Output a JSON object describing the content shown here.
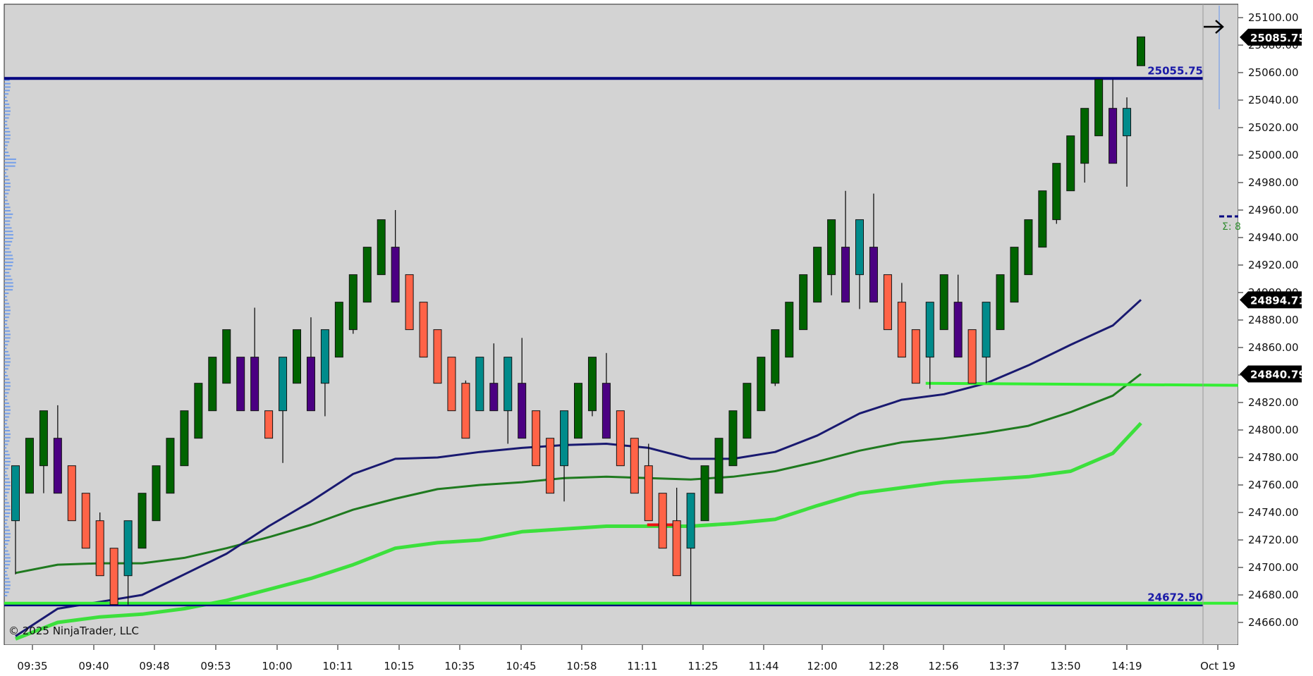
{
  "copyright": "© 2025 NinjaTrader, LLC",
  "sigma_label": "Σ: 8",
  "colors": {
    "background": "#d3d3d3",
    "bull": "#006400",
    "bear": "#ff6347",
    "bull_alt": "#008b8b",
    "bear_alt": "#4b0082",
    "ema_fast": "#191970",
    "ema_mid": "#1f7a1f",
    "ema_slow": "#3ce03c",
    "level_line": "#000080",
    "level_green": "#33ee33",
    "volume_profile": "#6495ed",
    "price_tag_bg": "#000000"
  },
  "chart_data": {
    "type": "candlestick",
    "instrument_timeframe_note": "",
    "x_tick_labels": [
      "09:35",
      "09:40",
      "09:48",
      "09:53",
      "10:00",
      "10:11",
      "10:15",
      "10:35",
      "10:45",
      "10:58",
      "11:11",
      "11:25",
      "11:44",
      "12:00",
      "12:28",
      "12:56",
      "13:37",
      "13:50",
      "14:19",
      "Oct 19"
    ],
    "y_ticks": [
      25100,
      25080,
      25060,
      25040,
      25020,
      25000,
      24980,
      24960,
      24940,
      24920,
      24900,
      24880,
      24860,
      24840,
      24820,
      24800,
      24780,
      24760,
      24740,
      24720,
      24700,
      24680,
      24660
    ],
    "y_tick_labels": [
      "25100.00",
      "25080.00",
      "25060.00",
      "25040.00",
      "25020.00",
      "25000.00",
      "24980.00",
      "24960.00",
      "24940.00",
      "24920.00",
      "24900.00",
      "24880.00",
      "24860.00",
      "24840.00",
      "24820.00",
      "24800.00",
      "24780.00",
      "24760.00",
      "24740.00",
      "24720.00",
      "24700.00",
      "24680.00",
      "24660.00"
    ],
    "ylim": [
      24648,
      25106
    ],
    "grid": false,
    "candles": [
      {
        "o": 24734,
        "h": 24774,
        "l": 24695,
        "c": 24774,
        "k": "bull_alt"
      },
      {
        "o": 24754,
        "h": 24794,
        "l": 24754,
        "c": 24794,
        "k": "bull"
      },
      {
        "o": 24774,
        "h": 24814,
        "l": 24754,
        "c": 24814,
        "k": "bull"
      },
      {
        "o": 24794,
        "h": 24818,
        "l": 24754,
        "c": 24754,
        "k": "bear_alt"
      },
      {
        "o": 24774,
        "h": 24774,
        "l": 24734,
        "c": 24734,
        "k": "bear"
      },
      {
        "o": 24754,
        "h": 24754,
        "l": 24714,
        "c": 24714,
        "k": "bear"
      },
      {
        "o": 24734,
        "h": 24740,
        "l": 24694,
        "c": 24694,
        "k": "bear"
      },
      {
        "o": 24714,
        "h": 24714,
        "l": 24673,
        "c": 24673,
        "k": "bear"
      },
      {
        "o": 24694,
        "h": 24734,
        "l": 24673,
        "c": 24734,
        "k": "bull_alt"
      },
      {
        "o": 24714,
        "h": 24754,
        "l": 24714,
        "c": 24754,
        "k": "bull"
      },
      {
        "o": 24734,
        "h": 24774,
        "l": 24734,
        "c": 24774,
        "k": "bull"
      },
      {
        "o": 24754,
        "h": 24794,
        "l": 24754,
        "c": 24794,
        "k": "bull"
      },
      {
        "o": 24774,
        "h": 24814,
        "l": 24774,
        "c": 24814,
        "k": "bull"
      },
      {
        "o": 24794,
        "h": 24834,
        "l": 24794,
        "c": 24834,
        "k": "bull"
      },
      {
        "o": 24814,
        "h": 24853,
        "l": 24814,
        "c": 24853,
        "k": "bull"
      },
      {
        "o": 24834,
        "h": 24873,
        "l": 24834,
        "c": 24873,
        "k": "bull"
      },
      {
        "o": 24853,
        "h": 24853,
        "l": 24814,
        "c": 24814,
        "k": "bear_alt"
      },
      {
        "o": 24853,
        "h": 24889,
        "l": 24814,
        "c": 24814,
        "k": "bear_alt"
      },
      {
        "o": 24814,
        "h": 24814,
        "l": 24794,
        "c": 24794,
        "k": "bear"
      },
      {
        "o": 24814,
        "h": 24853,
        "l": 24776,
        "c": 24853,
        "k": "bull_alt"
      },
      {
        "o": 24834,
        "h": 24873,
        "l": 24834,
        "c": 24873,
        "k": "bull"
      },
      {
        "o": 24853,
        "h": 24882,
        "l": 24814,
        "c": 24814,
        "k": "bear_alt"
      },
      {
        "o": 24834,
        "h": 24873,
        "l": 24810,
        "c": 24873,
        "k": "bull_alt"
      },
      {
        "o": 24853,
        "h": 24893,
        "l": 24853,
        "c": 24893,
        "k": "bull"
      },
      {
        "o": 24873,
        "h": 24913,
        "l": 24870,
        "c": 24913,
        "k": "bull"
      },
      {
        "o": 24893,
        "h": 24933,
        "l": 24893,
        "c": 24933,
        "k": "bull"
      },
      {
        "o": 24913,
        "h": 24953,
        "l": 24913,
        "c": 24953,
        "k": "bull"
      },
      {
        "o": 24933,
        "h": 24960,
        "l": 24893,
        "c": 24893,
        "k": "bear_alt"
      },
      {
        "o": 24913,
        "h": 24913,
        "l": 24873,
        "c": 24873,
        "k": "bear"
      },
      {
        "o": 24893,
        "h": 24893,
        "l": 24853,
        "c": 24853,
        "k": "bear"
      },
      {
        "o": 24873,
        "h": 24873,
        "l": 24834,
        "c": 24834,
        "k": "bear"
      },
      {
        "o": 24853,
        "h": 24853,
        "l": 24814,
        "c": 24814,
        "k": "bear"
      },
      {
        "o": 24834,
        "h": 24836,
        "l": 24794,
        "c": 24794,
        "k": "bear"
      },
      {
        "o": 24814,
        "h": 24853,
        "l": 24814,
        "c": 24853,
        "k": "bull_alt"
      },
      {
        "o": 24834,
        "h": 24863,
        "l": 24814,
        "c": 24814,
        "k": "bear_alt"
      },
      {
        "o": 24814,
        "h": 24853,
        "l": 24790,
        "c": 24853,
        "k": "bull_alt"
      },
      {
        "o": 24834,
        "h": 24867,
        "l": 24794,
        "c": 24794,
        "k": "bear_alt"
      },
      {
        "o": 24814,
        "h": 24814,
        "l": 24774,
        "c": 24774,
        "k": "bear"
      },
      {
        "o": 24794,
        "h": 24794,
        "l": 24754,
        "c": 24754,
        "k": "bear"
      },
      {
        "o": 24774,
        "h": 24814,
        "l": 24748,
        "c": 24814,
        "k": "bull_alt"
      },
      {
        "o": 24794,
        "h": 24834,
        "l": 24794,
        "c": 24834,
        "k": "bull"
      },
      {
        "o": 24814,
        "h": 24853,
        "l": 24810,
        "c": 24853,
        "k": "bull"
      },
      {
        "o": 24834,
        "h": 24856,
        "l": 24794,
        "c": 24794,
        "k": "bear_alt"
      },
      {
        "o": 24814,
        "h": 24814,
        "l": 24774,
        "c": 24774,
        "k": "bear"
      },
      {
        "o": 24794,
        "h": 24794,
        "l": 24754,
        "c": 24754,
        "k": "bear"
      },
      {
        "o": 24774,
        "h": 24790,
        "l": 24734,
        "c": 24734,
        "k": "bear"
      },
      {
        "o": 24754,
        "h": 24754,
        "l": 24714,
        "c": 24714,
        "k": "bear"
      },
      {
        "o": 24734,
        "h": 24758,
        "l": 24694,
        "c": 24694,
        "k": "bear"
      },
      {
        "o": 24714,
        "h": 24754,
        "l": 24673,
        "c": 24754,
        "k": "bull_alt"
      },
      {
        "o": 24734,
        "h": 24774,
        "l": 24734,
        "c": 24774,
        "k": "bull"
      },
      {
        "o": 24754,
        "h": 24794,
        "l": 24754,
        "c": 24794,
        "k": "bull"
      },
      {
        "o": 24774,
        "h": 24814,
        "l": 24774,
        "c": 24814,
        "k": "bull"
      },
      {
        "o": 24794,
        "h": 24834,
        "l": 24794,
        "c": 24834,
        "k": "bull"
      },
      {
        "o": 24814,
        "h": 24853,
        "l": 24814,
        "c": 24853,
        "k": "bull"
      },
      {
        "o": 24834,
        "h": 24873,
        "l": 24832,
        "c": 24873,
        "k": "bull"
      },
      {
        "o": 24853,
        "h": 24893,
        "l": 24853,
        "c": 24893,
        "k": "bull"
      },
      {
        "o": 24873,
        "h": 24913,
        "l": 24873,
        "c": 24913,
        "k": "bull"
      },
      {
        "o": 24893,
        "h": 24933,
        "l": 24893,
        "c": 24933,
        "k": "bull"
      },
      {
        "o": 24913,
        "h": 24953,
        "l": 24898,
        "c": 24953,
        "k": "bull"
      },
      {
        "o": 24933,
        "h": 24974,
        "l": 24893,
        "c": 24893,
        "k": "bear_alt"
      },
      {
        "o": 24913,
        "h": 24953,
        "l": 24888,
        "c": 24953,
        "k": "bull_alt"
      },
      {
        "o": 24933,
        "h": 24972,
        "l": 24893,
        "c": 24893,
        "k": "bear_alt"
      },
      {
        "o": 24913,
        "h": 24913,
        "l": 24873,
        "c": 24873,
        "k": "bear"
      },
      {
        "o": 24893,
        "h": 24907,
        "l": 24853,
        "c": 24853,
        "k": "bear"
      },
      {
        "o": 24873,
        "h": 24873,
        "l": 24834,
        "c": 24834,
        "k": "bear"
      },
      {
        "o": 24853,
        "h": 24893,
        "l": 24830,
        "c": 24893,
        "k": "bull_alt"
      },
      {
        "o": 24873,
        "h": 24913,
        "l": 24873,
        "c": 24913,
        "k": "bull"
      },
      {
        "o": 24893,
        "h": 24913,
        "l": 24853,
        "c": 24853,
        "k": "bear_alt"
      },
      {
        "o": 24873,
        "h": 24873,
        "l": 24834,
        "c": 24834,
        "k": "bear"
      },
      {
        "o": 24853,
        "h": 24893,
        "l": 24834,
        "c": 24893,
        "k": "bull_alt"
      },
      {
        "o": 24873,
        "h": 24913,
        "l": 24873,
        "c": 24913,
        "k": "bull"
      },
      {
        "o": 24893,
        "h": 24933,
        "l": 24893,
        "c": 24933,
        "k": "bull"
      },
      {
        "o": 24913,
        "h": 24953,
        "l": 24913,
        "c": 24953,
        "k": "bull"
      },
      {
        "o": 24933,
        "h": 24974,
        "l": 24933,
        "c": 24974,
        "k": "bull"
      },
      {
        "o": 24953,
        "h": 24994,
        "l": 24950,
        "c": 24994,
        "k": "bull"
      },
      {
        "o": 24974,
        "h": 25014,
        "l": 24974,
        "c": 25014,
        "k": "bull"
      },
      {
        "o": 24994,
        "h": 25034,
        "l": 24980,
        "c": 25034,
        "k": "bull"
      },
      {
        "o": 25014,
        "h": 25055,
        "l": 25014,
        "c": 25055,
        "k": "bull"
      },
      {
        "o": 25034,
        "h": 25055,
        "l": 24994,
        "c": 24994,
        "k": "bear_alt"
      },
      {
        "o": 25014,
        "h": 25042,
        "l": 24977,
        "c": 25034,
        "k": "bull_alt"
      },
      {
        "o": 25065,
        "h": 25086,
        "l": 25065,
        "c": 25086,
        "k": "bull"
      }
    ],
    "ema_fast": [
      [
        0,
        24650
      ],
      [
        3,
        24670
      ],
      [
        6,
        24675
      ],
      [
        9,
        24680
      ],
      [
        12,
        24695
      ],
      [
        15,
        24710
      ],
      [
        18,
        24730
      ],
      [
        21,
        24748
      ],
      [
        24,
        24768
      ],
      [
        27,
        24779
      ],
      [
        30,
        24780
      ],
      [
        33,
        24784
      ],
      [
        36,
        24787
      ],
      [
        39,
        24789
      ],
      [
        42,
        24790
      ],
      [
        45,
        24787
      ],
      [
        48,
        24779
      ],
      [
        51,
        24779
      ],
      [
        54,
        24784
      ],
      [
        57,
        24796
      ],
      [
        60,
        24812
      ],
      [
        63,
        24822
      ],
      [
        66,
        24826
      ],
      [
        69,
        24834
      ],
      [
        72,
        24847
      ],
      [
        75,
        24862
      ],
      [
        78,
        24876
      ],
      [
        80,
        24894.71
      ]
    ],
    "ema_mid": [
      [
        0,
        24696
      ],
      [
        3,
        24702
      ],
      [
        6,
        24703
      ],
      [
        9,
        24703
      ],
      [
        12,
        24707
      ],
      [
        15,
        24714
      ],
      [
        18,
        24722
      ],
      [
        21,
        24731
      ],
      [
        24,
        24742
      ],
      [
        27,
        24750
      ],
      [
        30,
        24757
      ],
      [
        33,
        24760
      ],
      [
        36,
        24762
      ],
      [
        39,
        24765
      ],
      [
        42,
        24766
      ],
      [
        45,
        24765
      ],
      [
        48,
        24764
      ],
      [
        51,
        24766
      ],
      [
        54,
        24770
      ],
      [
        57,
        24777
      ],
      [
        60,
        24785
      ],
      [
        63,
        24791
      ],
      [
        66,
        24794
      ],
      [
        69,
        24798
      ],
      [
        72,
        24803
      ],
      [
        75,
        24813
      ],
      [
        78,
        24825
      ],
      [
        80,
        24840.79
      ]
    ],
    "ema_slow": [
      [
        0,
        24648
      ],
      [
        3,
        24660
      ],
      [
        6,
        24664
      ],
      [
        9,
        24666
      ],
      [
        12,
        24670
      ],
      [
        15,
        24676
      ],
      [
        18,
        24684
      ],
      [
        21,
        24692
      ],
      [
        24,
        24702
      ],
      [
        27,
        24714
      ],
      [
        30,
        24718
      ],
      [
        33,
        24720
      ],
      [
        36,
        24726
      ],
      [
        39,
        24728
      ],
      [
        42,
        24730
      ],
      [
        45,
        24730
      ],
      [
        48,
        24730
      ],
      [
        51,
        24732
      ],
      [
        54,
        24735
      ],
      [
        57,
        24745
      ],
      [
        60,
        24754
      ],
      [
        63,
        24758
      ],
      [
        66,
        24762
      ],
      [
        69,
        24764
      ],
      [
        72,
        24766
      ],
      [
        75,
        24770
      ],
      [
        78,
        24783
      ],
      [
        80,
        24805
      ]
    ],
    "levels": [
      {
        "label": "25055.75",
        "value": 25055.75
      },
      {
        "label": "24672.50",
        "value": 24672.5
      }
    ],
    "support_line": {
      "from_candle": 65,
      "value_start": 24834,
      "value_end": 24834
    },
    "price_tags": [
      {
        "label": "25085.75",
        "value": 25085.75
      },
      {
        "label": "24894.71",
        "value": 24894.71
      },
      {
        "label": "24840.79",
        "value": 24840.79
      }
    ]
  }
}
